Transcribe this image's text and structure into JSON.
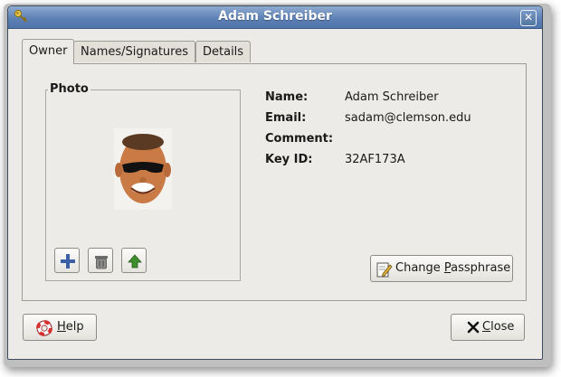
{
  "window": {
    "title": "Adam Schreiber",
    "close_glyph": "✕"
  },
  "tabs": [
    {
      "label": "Owner",
      "active": true
    },
    {
      "label": "Names/Signatures",
      "active": false
    },
    {
      "label": "Details",
      "active": false
    }
  ],
  "photo": {
    "legend": "Photo",
    "icons": [
      "add-photo-icon",
      "trash-icon",
      "up-arrow-icon"
    ]
  },
  "owner": {
    "name_label": "Name:",
    "name_value": "Adam Schreiber",
    "email_label": "Email:",
    "email_value": "sadam@clemson.edu",
    "comment_label": "Comment:",
    "comment_value": "",
    "keyid_label": "Key ID:",
    "keyid_value": "32AF173A"
  },
  "buttons": {
    "change_passphrase": {
      "prefix": "Change ",
      "mnemonic": "P",
      "suffix": "assphrase"
    },
    "help": {
      "prefix": "",
      "mnemonic": "H",
      "suffix": "elp"
    },
    "close": {
      "prefix": "",
      "mnemonic": "C",
      "suffix": "lose"
    }
  },
  "colors": {
    "titlebar": "#5e82b6",
    "window_bg": "#edebe7",
    "border": "#9d9b96"
  }
}
